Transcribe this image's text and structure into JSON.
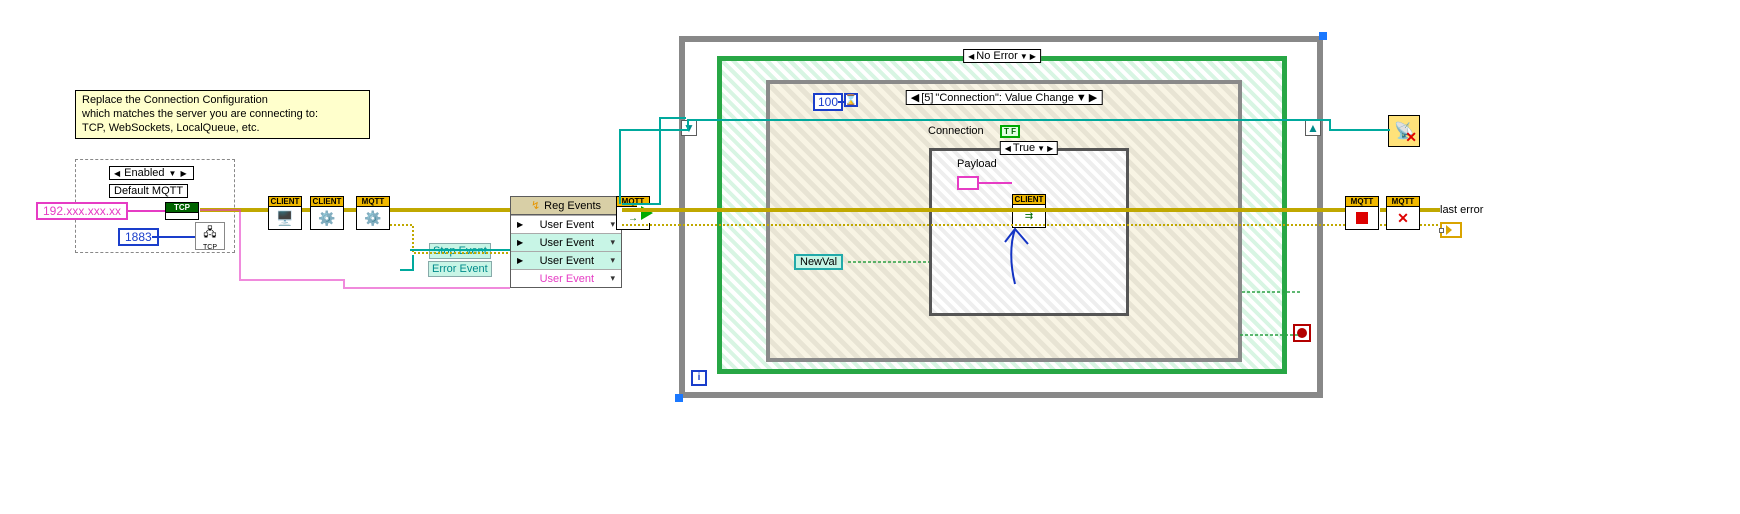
{
  "comment": {
    "line1": "Replace the Connection Configuration",
    "line2": "which matches the server you are connecting to:",
    "line3": "TCP, WebSockets, LocalQueue, etc."
  },
  "enabled_ring": "Enabled",
  "default_mqtt_label": "Default MQTT",
  "server_ip": "192.xxx.xxx.xx",
  "server_port": "1883",
  "tcp_header": "TCP",
  "tcp_footer_label": "TCP",
  "client_headers": [
    "CLIENT",
    "CLIENT"
  ],
  "mqtt_headers": [
    "MQTT",
    "MQTT",
    "MQTT",
    "MQTT"
  ],
  "reg_events": {
    "title": "Reg Events",
    "row_labels_left": [
      "Stop Event",
      "Error Event"
    ],
    "row_labels_right": [
      "User Event",
      "User Event",
      "User Event"
    ]
  },
  "loop": {
    "timeout_value": "100",
    "iter_glyph": "i"
  },
  "outer_case_selector": "No Error",
  "event_selector_index": "[5]",
  "event_selector_text": "\"Connection\": Value Change",
  "event_data_node": "NewVal",
  "connection_label": "Connection",
  "bool_term_text": "T F",
  "inner_case_selector": "True",
  "payload_label": "Payload",
  "inner_client_header": "CLIENT",
  "last_error_label": "last error"
}
